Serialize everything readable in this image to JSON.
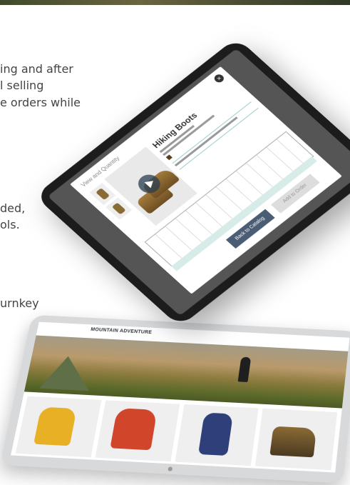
{
  "copy": {
    "line1": "ing and after",
    "line2": "l selling",
    "line3": "e orders while",
    "line4": "ded,",
    "line5": "ols.",
    "line6": "urnkey"
  },
  "modal": {
    "title": "View and Quantity",
    "close": "×",
    "product_name": "Hiking Boots",
    "back_button": "Back to Catalog",
    "add_button": "Add to Order"
  },
  "store": {
    "logo": "MOUNTAIN ADVENTURE"
  }
}
